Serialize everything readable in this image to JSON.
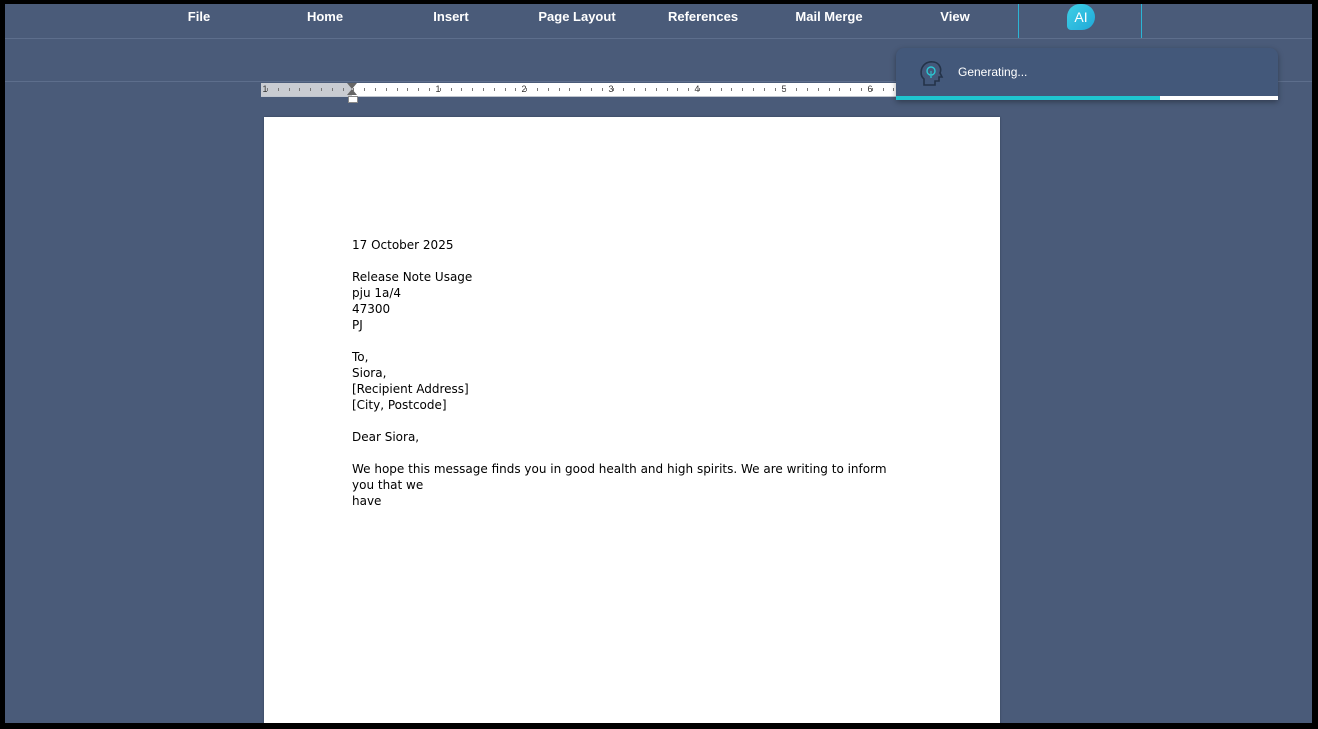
{
  "menu": {
    "items": [
      {
        "label": "File"
      },
      {
        "label": "Home"
      },
      {
        "label": "Insert"
      },
      {
        "label": "Page Layout"
      },
      {
        "label": "References"
      },
      {
        "label": "Mail Merge"
      },
      {
        "label": "View"
      }
    ],
    "ai_tab": {
      "label": "AI"
    }
  },
  "ruler": {
    "numbers": [
      "1",
      "1",
      "2",
      "3",
      "4",
      "5",
      "6"
    ]
  },
  "document": {
    "lines": [
      "17 October 2025",
      "",
      "Release Note Usage",
      "pju 1a/4",
      "47300",
      "PJ",
      "",
      "To,",
      "Siora,",
      "[Recipient Address]",
      "[City, Postcode]",
      "",
      "Dear Siora,",
      "",
      "We hope this message finds you in good health and high spirits. We are writing to inform you that we",
      "have"
    ]
  },
  "toast": {
    "text": "Generating...",
    "icon": "lightbulb-head-icon",
    "progress": 0.69
  },
  "colors": {
    "app_bg": "#4a5b79",
    "accent": "#1fc5cf"
  }
}
